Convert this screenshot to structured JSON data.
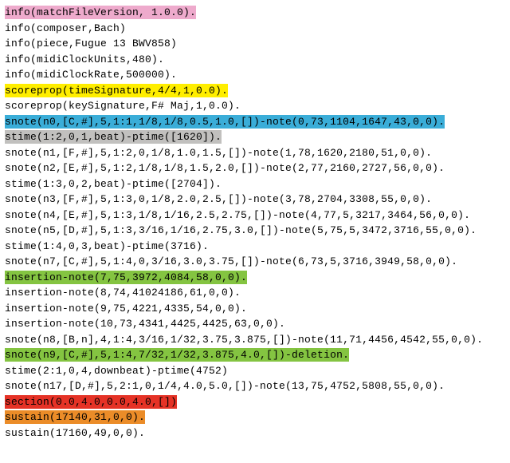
{
  "lines": [
    {
      "text": "info(matchFileVersion, 1.0.0).",
      "hl": "pink"
    },
    {
      "text": "info(composer,Bach)",
      "hl": null
    },
    {
      "text": "info(piece,Fugue 13 BWV858)",
      "hl": null
    },
    {
      "text": "info(midiClockUnits,480).",
      "hl": null
    },
    {
      "text": "info(midiClockRate,500000).",
      "hl": null
    },
    {
      "text": " scoreprop(timeSignature,4/4,1,0.0).",
      "hl": "yellow"
    },
    {
      "text": "scoreprop(keySignature,F# Maj,1,0.0).",
      "hl": null
    },
    {
      "text": " snote(n0,[C,#],5,1:1,1/8,1/8,0.5,1.0,[])-note(0,73,1104,1647,43,0,0).",
      "hl": "blue"
    },
    {
      "text": " stime(1:2,0,1,beat)-ptime([1620]).",
      "hl": "gray"
    },
    {
      "text": "snote(n1,[F,#],5,1:2,0,1/8,1.0,1.5,[])-note(1,78,1620,2180,51,0,0).",
      "hl": null
    },
    {
      "text": "snote(n2,[E,#],5,1:2,1/8,1/8,1.5,2.0,[])-note(2,77,2160,2727,56,0,0).",
      "hl": null
    },
    {
      "text": "stime(1:3,0,2,beat)-ptime([2704]).",
      "hl": null
    },
    {
      "text": "snote(n3,[F,#],5,1:3,0,1/8,2.0,2.5,[])-note(3,78,2704,3308,55,0,0).",
      "hl": null
    },
    {
      "text": "snote(n4,[E,#],5,1:3,1/8,1/16,2.5,2.75,[])-note(4,77,5,3217,3464,56,0,0).",
      "hl": null
    },
    {
      "text": "snote(n5,[D,#],5,1:3,3/16,1/16,2.75,3.0,[])-note(5,75,5,3472,3716,55,0,0).",
      "hl": null
    },
    {
      "text": "stime(1:4,0,3,beat)-ptime(3716).",
      "hl": null
    },
    {
      "text": "snote(n7,[C,#],5,1:4,0,3/16,3.0,3.75,[])-note(6,73,5,3716,3949,58,0,0).",
      "hl": null
    },
    {
      "text": " insertion-note(7,75,3972,4084,58,0,0).",
      "hl": "green"
    },
    {
      "text": "insertion-note(8,74,41024186,61,0,0).",
      "hl": null
    },
    {
      "text": "insertion-note(9,75,4221,4335,54,0,0).",
      "hl": null
    },
    {
      "text": "insertion-note(10,73,4341,4425,4425,63,0,0).",
      "hl": null
    },
    {
      "text": "snote(n8,[B,n],4,1:4,3/16,1/32,3.75,3.875,[])-note(11,71,4456,4542,55,0,0).",
      "hl": null
    },
    {
      "text": " snote(n9,[C,#],5,1:4,7/32,1/32,3.875,4.0,[])-deletion.",
      "hl": "green"
    },
    {
      "text": "stime(2:1,0,4,downbeat)-ptime(4752)",
      "hl": null
    },
    {
      "text": "snote(n17,[D,#],5,2:1,0,1/4,4.0,5.0,[])-note(13,75,4752,5808,55,0,0).",
      "hl": null
    },
    {
      "text": " section(0.0,4.0,0.0,4.0,[])",
      "hl": "red"
    },
    {
      "text": " sustain(17140,31,0,0).",
      "hl": "orange"
    },
    {
      "text": "sustain(17160,49,0,0).",
      "hl": null
    }
  ]
}
